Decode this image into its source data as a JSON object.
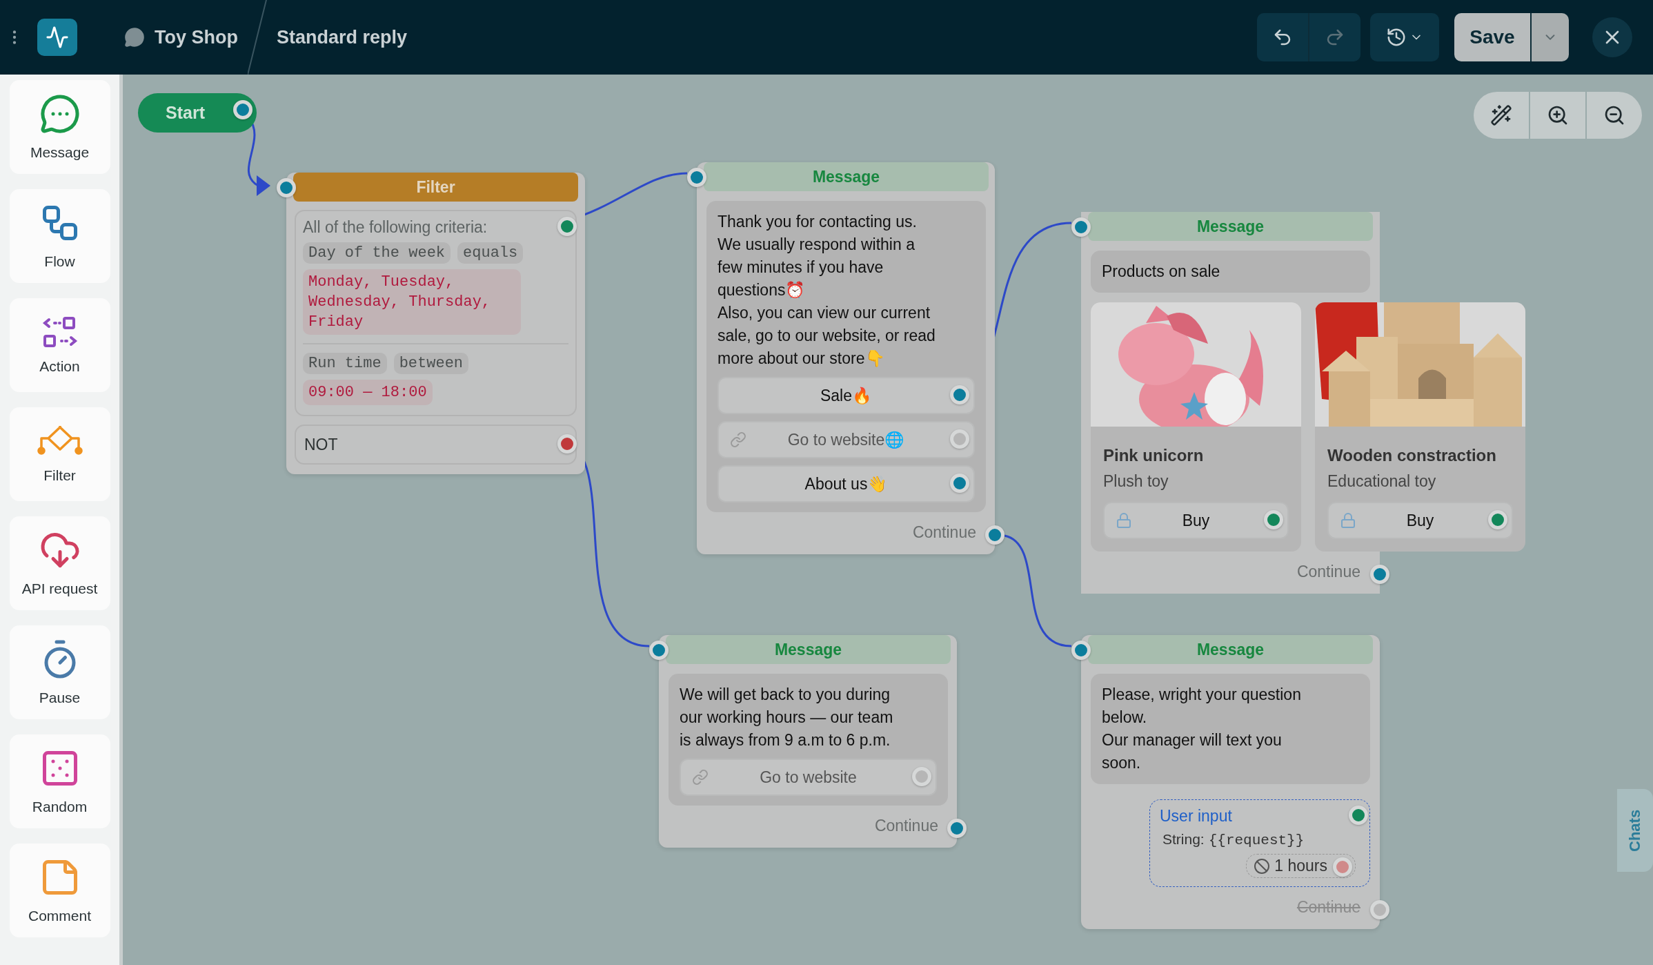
{
  "topbar": {
    "channel": "Toy Shop",
    "title": "Standard reply",
    "undo": {
      "disabled": false
    },
    "redo": {
      "disabled": true
    },
    "save": "Save"
  },
  "sidebar": {
    "tools": [
      {
        "label": "Message"
      },
      {
        "label": "Flow"
      },
      {
        "label": "Action"
      },
      {
        "label": "Filter"
      },
      {
        "label": "API request"
      },
      {
        "label": "Pause"
      },
      {
        "label": "Random"
      },
      {
        "label": "Comment"
      }
    ]
  },
  "canvas": {
    "nodes": [
      {
        "kind": "start",
        "label": "Start",
        "port": {
          "color": "#0b7d9c"
        }
      },
      {
        "kind": "filter",
        "title": "Filter",
        "port": {
          "color": "#0b7d9c"
        },
        "group": {
          "heading": "All of the following criteria:",
          "port": {
            "color": "#13875a"
          },
          "conditions": [
            {
              "field": "Day of the week",
              "operator": "equals",
              "value": "Monday, Tuesday, Wednesday, Thursday, Friday"
            },
            {
              "field": "Run time",
              "operator": "between",
              "value": "09:00 — 18:00"
            }
          ]
        },
        "negation": {
          "label": "NOT",
          "port": {
            "color": "#c0393b"
          }
        }
      },
      {
        "kind": "message",
        "title": "Message",
        "port": {
          "color": "#0b7d9c"
        },
        "bubble": {
          "text": "Thank you for contacting us.\nWe usually respond within a\nfew minutes if you have\nquestions⏰\nAlso, you can view our current\nsale, go to our website, or read\nmore about our store👇",
          "buttons": [
            {
              "kind": "reply",
              "label": "Sale🔥",
              "port": {
                "color": "#0b7d9c"
              }
            },
            {
              "kind": "url",
              "label": "Go to website🌐",
              "port": {
                "color": "#b6b6b6"
              }
            },
            {
              "kind": "reply",
              "label": "About us👋",
              "port": {
                "color": "#0b7d9c"
              }
            }
          ]
        },
        "continue": {
          "label": "Continue",
          "disabled": false,
          "port": {
            "color": "#0b7d9c"
          }
        }
      },
      {
        "kind": "message",
        "title": "Message",
        "port": {
          "color": "#0b7d9c"
        },
        "bubble": {
          "text": "Products on sale"
        },
        "cards": [
          {
            "title": "Pink unicorn",
            "subtitle": "Plush toy",
            "button": {
              "kind": "buy",
              "label": "Buy",
              "port": {
                "color": "#13875a"
              }
            }
          },
          {
            "title": "Wooden constraction",
            "subtitle": "Educational toy",
            "button": {
              "kind": "buy",
              "label": "Buy",
              "port": {
                "color": "#13875a"
              }
            }
          }
        ],
        "continue": {
          "label": "Continue",
          "disabled": false,
          "port": {
            "color": "#0b7d9c"
          }
        }
      },
      {
        "kind": "message",
        "title": "Message",
        "port": {
          "color": "#0b7d9c"
        },
        "bubble": {
          "text": "We will get back to you during\nour working hours — our team\nis always from 9 a.m to 6 p.m.",
          "buttons": [
            {
              "kind": "url",
              "label": "Go to website",
              "port": {
                "color": "#b6b6b6"
              }
            }
          ]
        },
        "continue": {
          "label": "Continue",
          "disabled": false,
          "port": {
            "color": "#0b7d9c"
          }
        }
      },
      {
        "kind": "message",
        "title": "Message",
        "port": {
          "color": "#0b7d9c"
        },
        "bubble": {
          "text": "Please, wright your question\nbelow.\nOur manager will text you\nsoon."
        },
        "user_input": {
          "title": "User input",
          "port": {
            "color": "#13875a"
          },
          "type_label": "String:",
          "variable": "{{request}}",
          "timeout": "1 hours",
          "timeout_port": {
            "color": "#d08a8a"
          }
        },
        "continue": {
          "label": "Continue",
          "disabled": true,
          "port": {
            "color": "#b6b6b6"
          }
        }
      }
    ]
  },
  "chats_tab": "Chats"
}
